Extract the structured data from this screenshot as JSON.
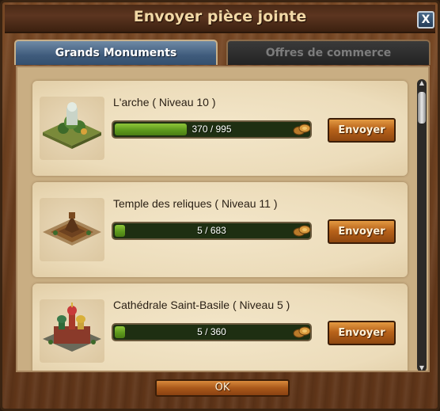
{
  "dialog": {
    "title": "Envoyer pièce jointe",
    "close_label": "X",
    "ok_label": "OK"
  },
  "tabs": [
    {
      "label": "Grands Monuments",
      "active": true
    },
    {
      "label": "Offres de commerce",
      "active": false
    }
  ],
  "monuments": [
    {
      "name": "L'arche ( Niveau 10 )",
      "progress_text": "370 / 995",
      "progress": 0.372,
      "button": "Envoyer",
      "icon": "ark-building-icon"
    },
    {
      "name": "Temple des reliques ( Niveau 11 )",
      "progress_text": "5 / 683",
      "progress": 0.007,
      "button": "Envoyer",
      "icon": "temple-building-icon"
    },
    {
      "name": "Cathédrale Saint-Basile ( Niveau 5 )",
      "progress_text": "5 / 360",
      "progress": 0.014,
      "button": "Envoyer",
      "icon": "cathedral-building-icon"
    }
  ],
  "colors": {
    "progress_fill": "#6aa526",
    "progress_track": "#1e2f12",
    "send_button": "#b8631a",
    "active_tab": "#3f5b7c"
  },
  "forge_points_icon": "forge-points-coins-icon"
}
